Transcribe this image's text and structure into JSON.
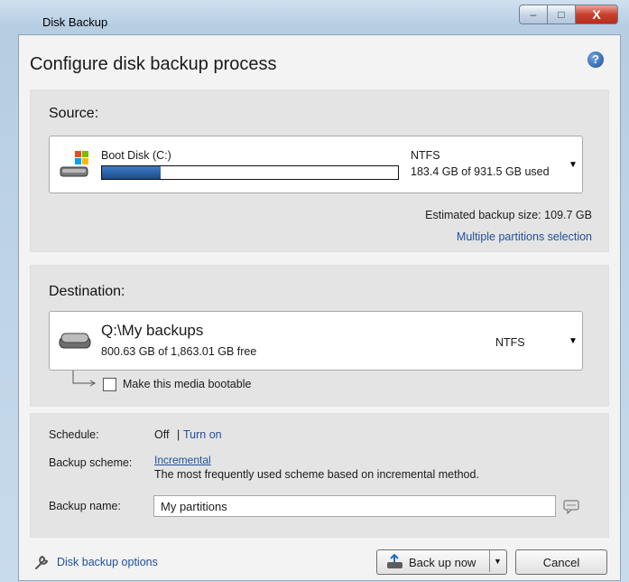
{
  "window": {
    "title": "Disk Backup",
    "controls": {
      "minimize": "–",
      "maximize": "□",
      "close": "X"
    }
  },
  "heading": "Configure disk backup process",
  "help_icon": "?",
  "source": {
    "label": "Source:",
    "disk_name": "Boot Disk (C:)",
    "filesystem": "NTFS",
    "usage": "183.4 GB of 931.5 GB used",
    "used_fraction": 0.197,
    "estimated": "Estimated backup size: 109.7 GB",
    "multi_link": "Multiple partitions selection"
  },
  "destination": {
    "label": "Destination:",
    "path": "Q:\\My backups",
    "free": "800.63 GB of 1,863.01 GB free",
    "filesystem": "NTFS",
    "bootable_label": "Make this media bootable",
    "bootable_checked": false
  },
  "settings": {
    "schedule_label": "Schedule:",
    "schedule_value": "Off",
    "schedule_sep": "|",
    "schedule_link": "Turn on",
    "scheme_label": "Backup scheme:",
    "scheme_link": "Incremental",
    "scheme_desc": "The most frequently used scheme based on incremental method.",
    "name_label": "Backup name:",
    "name_value": "My partitions"
  },
  "footer": {
    "options_link": "Disk backup options",
    "backup_button": "Back up now",
    "cancel_button": "Cancel"
  }
}
